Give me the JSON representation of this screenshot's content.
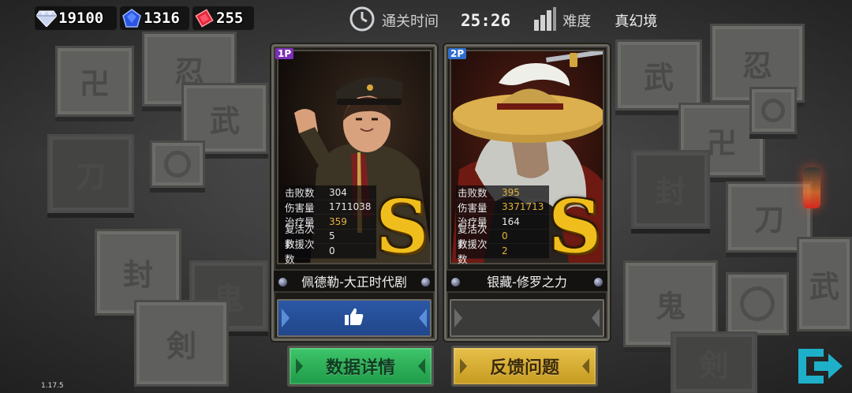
{
  "currencies": [
    {
      "icon": "diamond-icon",
      "value": "19100",
      "color": "#c9d4f0"
    },
    {
      "icon": "sapphire-icon",
      "value": "1316",
      "color": "#2a55e0"
    },
    {
      "icon": "ruby-icon",
      "value": "255",
      "color": "#e0283a"
    }
  ],
  "header": {
    "clear_time_label": "通关时间",
    "clear_time": "25:26",
    "difficulty_label": "难度",
    "difficulty": "真幻境"
  },
  "players": [
    {
      "badge": "1P",
      "badge_color": "#7a2fb8",
      "name": "佩德勒-大正时代剧",
      "grade": "S",
      "liked": true,
      "stats": [
        {
          "label": "击败数",
          "value": "304",
          "highlight": false
        },
        {
          "label": "伤害量",
          "value": "1711038",
          "highlight": false
        },
        {
          "label": "治疗量",
          "value": "359",
          "highlight": true
        },
        {
          "label": "复活次数",
          "value": "5",
          "highlight": false
        },
        {
          "label": "救援次数",
          "value": "0",
          "highlight": false
        }
      ]
    },
    {
      "badge": "2P",
      "badge_color": "#2f6fd0",
      "name": "银藏-修罗之力",
      "grade": "S",
      "liked": false,
      "stats": [
        {
          "label": "击败数",
          "value": "395",
          "highlight": true
        },
        {
          "label": "伤害量",
          "value": "3371713",
          "highlight": true
        },
        {
          "label": "治疗量",
          "value": "164",
          "highlight": false
        },
        {
          "label": "复活次数",
          "value": "0",
          "highlight": true
        },
        {
          "label": "救援次数",
          "value": "2",
          "highlight": true
        }
      ]
    }
  ],
  "buttons": {
    "details": "数据详情",
    "feedback": "反馈问题"
  },
  "version": "1.17.5"
}
